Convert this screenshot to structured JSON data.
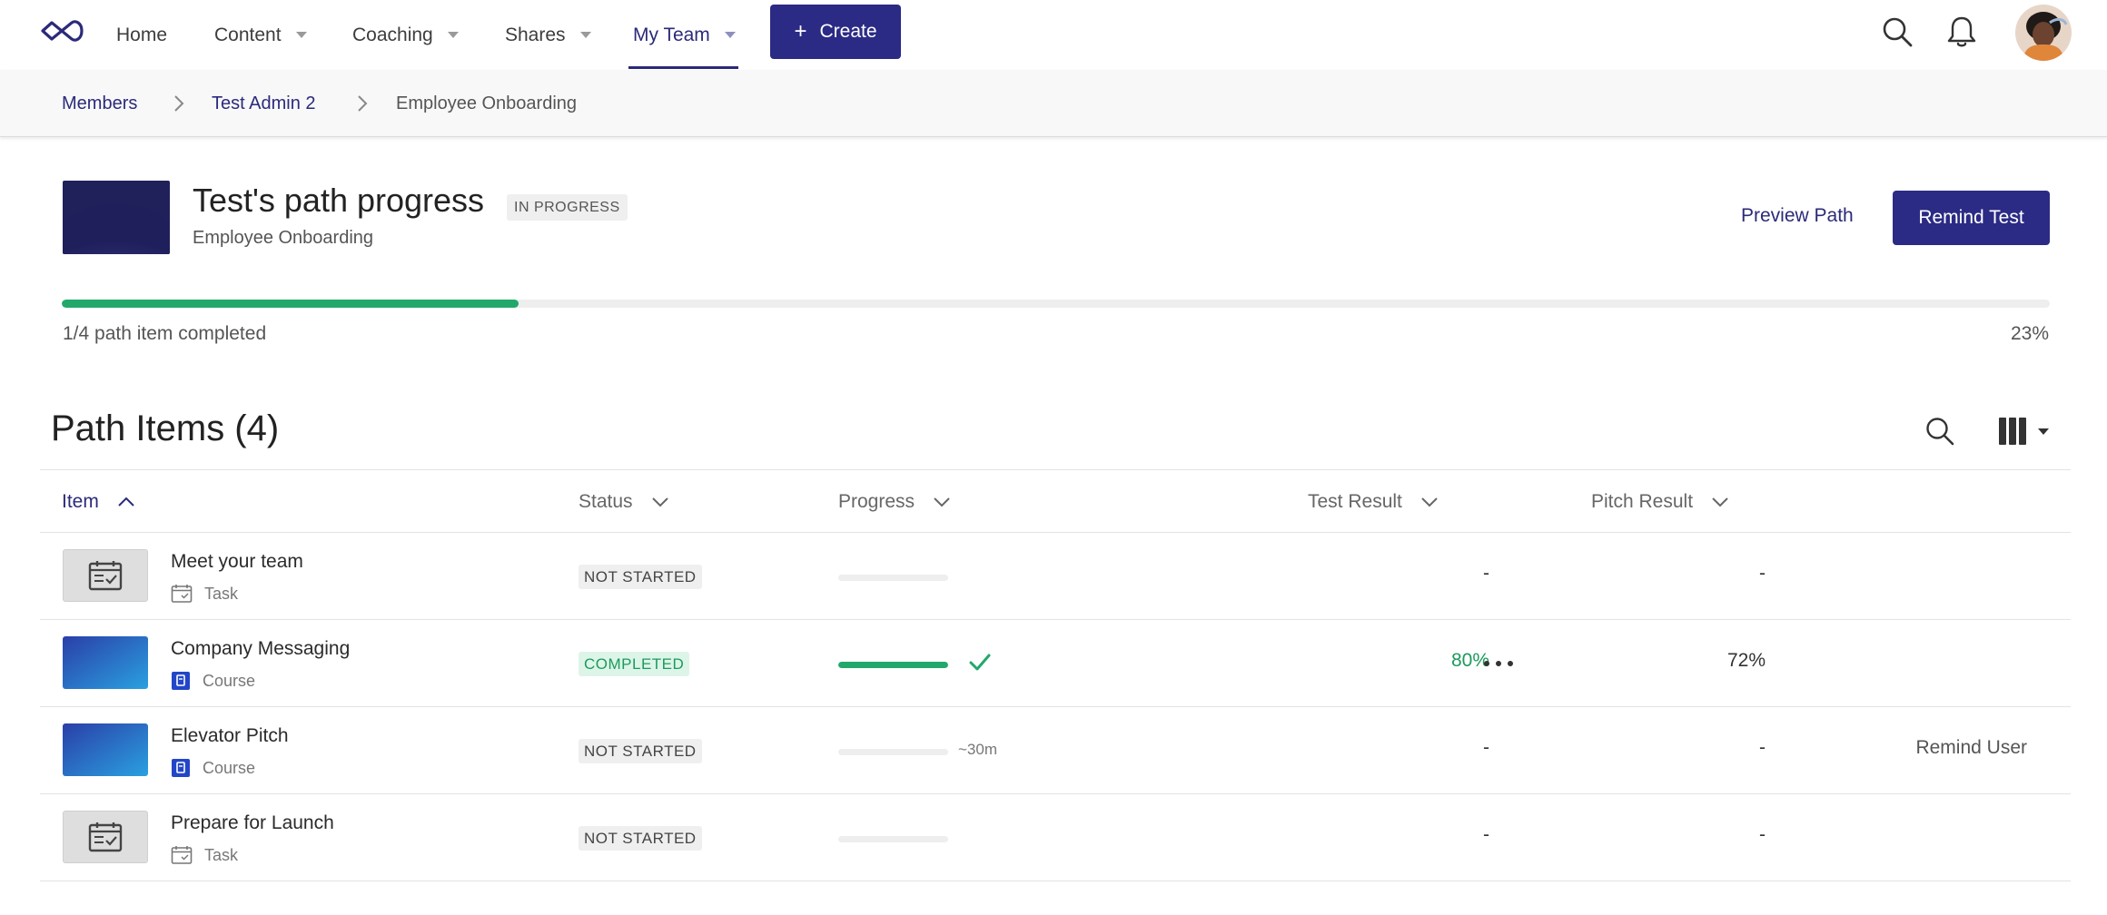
{
  "nav": {
    "items": [
      {
        "label": "Home",
        "has_caret": false
      },
      {
        "label": "Content",
        "has_caret": true
      },
      {
        "label": "Coaching",
        "has_caret": true
      },
      {
        "label": "Shares",
        "has_caret": true
      },
      {
        "label": "My Team",
        "has_caret": true,
        "active": true
      }
    ],
    "create_label": "Create",
    "icons": [
      "infinity-logo-icon",
      "search-icon",
      "bell-icon",
      "avatar"
    ]
  },
  "breadcrumb": {
    "items": [
      "Members",
      "Test Admin 2",
      "Employee Onboarding"
    ]
  },
  "header": {
    "title": "Test's path progress",
    "status_badge": "IN PROGRESS",
    "subtitle": "Employee Onboarding",
    "preview_label": "Preview Path",
    "remind_label": "Remind Test"
  },
  "progress": {
    "caption": "1/4 path item completed",
    "percent_label": "23%",
    "fraction": 0.23
  },
  "section": {
    "title": "Path Items (4)"
  },
  "table": {
    "columns": {
      "item": "Item",
      "status": "Status",
      "progress": "Progress",
      "test_result": "Test Result",
      "pitch_result": "Pitch Result"
    },
    "rows": [
      {
        "title": "Meet your team",
        "type": "Task",
        "status": "NOT STARTED",
        "progress": 0,
        "eta": "",
        "test": "-",
        "pitch": "-",
        "action": ""
      },
      {
        "title": "Company Messaging",
        "type": "Course",
        "status": "COMPLETED",
        "progress": 1,
        "eta": "",
        "test": "80%",
        "pitch": "72%",
        "action": ""
      },
      {
        "title": "Elevator Pitch",
        "type": "Course",
        "status": "NOT STARTED",
        "progress": 0,
        "eta": "~30m",
        "test": "-",
        "pitch": "-",
        "action": "Remind User"
      },
      {
        "title": "Prepare for Launch",
        "type": "Task",
        "status": "NOT STARTED",
        "progress": 0,
        "eta": "",
        "test": "-",
        "pitch": "-",
        "action": ""
      }
    ]
  },
  "colors": {
    "brand": "#2b2b85",
    "success": "#22a86b",
    "course_icon": "#2346c8"
  }
}
